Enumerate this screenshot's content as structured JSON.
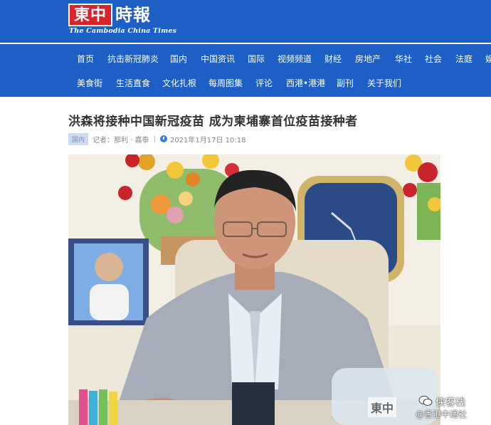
{
  "site": {
    "logo_cn": "東中",
    "logo_cn_rest": "時報",
    "logo_en": "The Cambodia China Times"
  },
  "nav": {
    "row1": [
      "首页",
      "抗击新冠肺炎",
      "国内",
      "中国资讯",
      "国际",
      "视频频道",
      "财经",
      "房地产",
      "华社",
      "社会",
      "法庭",
      "娱"
    ],
    "row2": [
      "美食街",
      "生活直食",
      "文化扎根",
      "每周图集",
      "评论",
      "西港•港港",
      "副刊",
      "关于我们"
    ]
  },
  "article": {
    "title": "洪森将接种中国新冠疫苗 成为柬埔寨首位疫苗接种者",
    "category": "国内",
    "author": "记者：那利 · 嘉泰",
    "separator": "|",
    "date": "2021年1月17日 10:18"
  },
  "photo": {
    "alt": "Man in grey suit seated at desk"
  },
  "watermark": {
    "logo": "東中",
    "text1": "侠客栈",
    "text2": "@香港中通社"
  },
  "colors": {
    "header_blue": "#1d5fc4",
    "logo_red": "#d8232a"
  }
}
